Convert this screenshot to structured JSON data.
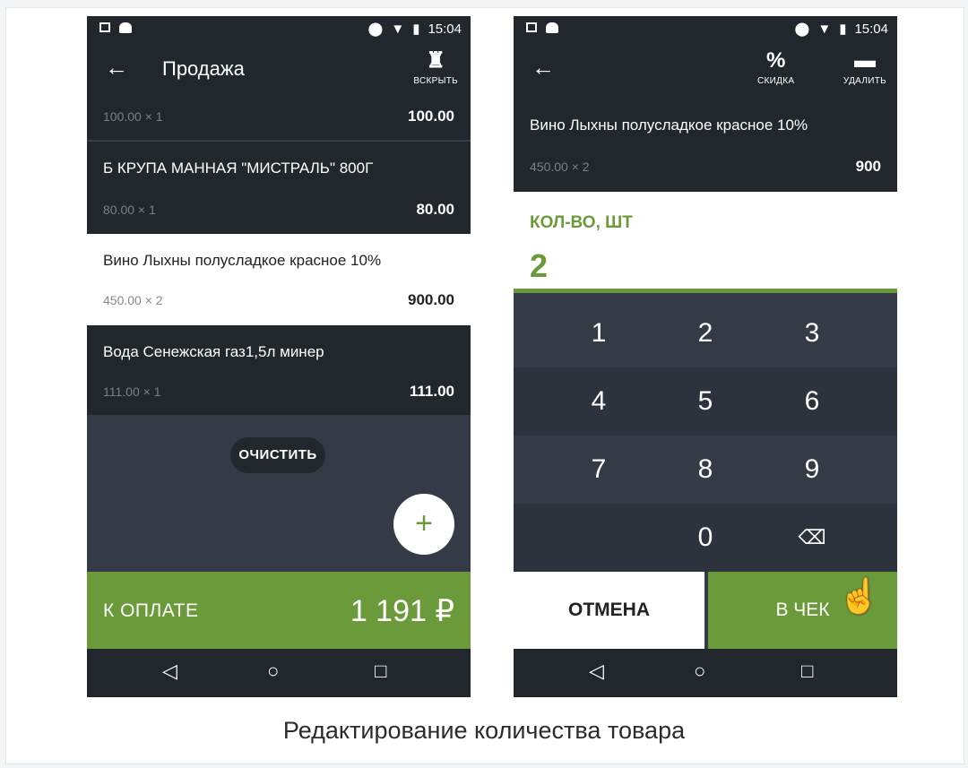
{
  "left": {
    "status": {
      "time": "15:04"
    },
    "toolbar": {
      "title": "Продажа",
      "open_label": "ВСКРЫТЬ"
    },
    "items": [
      {
        "qty": "100.00 × 1",
        "sum": "100.00"
      },
      {
        "name": "Б КРУПА МАННАЯ \"МИСТРАЛЬ\"  800Г",
        "qty": "80.00 × 1",
        "sum": "80.00"
      },
      {
        "name": "Вино Лыхны полусладкое красное 10%",
        "qty": "450.00 × 2",
        "sum": "900.00"
      },
      {
        "name": "Вода Сенежская газ1,5л минер",
        "qty": "111.00 × 1",
        "sum": "111.00"
      }
    ],
    "clear_label": "ОЧИСТИТЬ",
    "fab_label": "+",
    "pay_label": "К ОПЛАТЕ",
    "pay_amount": "1 191 ₽"
  },
  "right": {
    "status": {
      "time": "15:04"
    },
    "toolbar": {
      "discount_label": "СКИДКА",
      "delete_label": "УДАЛИТЬ"
    },
    "item": {
      "name": "Вино Лыхны полусладкое красное 10%",
      "qty": "450.00 × 2",
      "sum": "900"
    },
    "qty_label": "КОЛ-ВО, ШТ",
    "qty_value": "2",
    "keys": [
      "1",
      "2",
      "3",
      "4",
      "5",
      "6",
      "7",
      "8",
      "9",
      "0"
    ],
    "cancel_label": "ОТМЕНА",
    "ok_label": "В ЧЕК"
  },
  "icons": {
    "back": "arrow-left-icon",
    "open": "bottle-icon",
    "discount": "percent-icon",
    "delete": "trash-icon",
    "backspace": "backspace-icon",
    "nav_back": "triangle-back-icon",
    "nav_home": "circle-home-icon",
    "nav_recent": "square-recent-icon"
  },
  "colors": {
    "accent": "#6b9a3b",
    "dark": "#22262d",
    "panel": "#343b46"
  },
  "caption": "Редактирование количества товара"
}
